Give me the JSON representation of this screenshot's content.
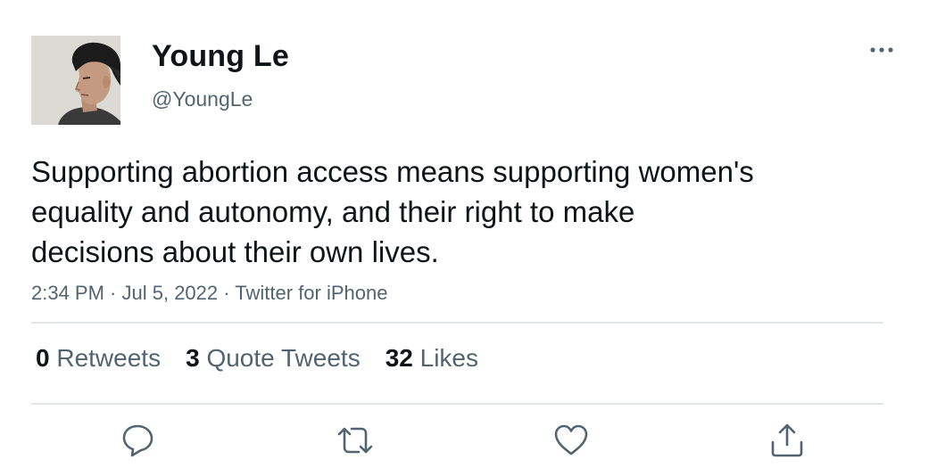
{
  "user": {
    "display_name": "Young Le",
    "handle": "@YoungLe"
  },
  "tweet": {
    "text_lines": [
      "Supporting abortion access means supporting women's",
      "equality and autonomy, and their right to make",
      "decisions about their own lives."
    ],
    "time": "2:34 PM",
    "date": "Jul 5, 2022",
    "source": "Twitter for iPhone",
    "separator": " · "
  },
  "stats": {
    "retweets_count": "0",
    "retweets_label": "Retweets",
    "quotes_count": "3",
    "quotes_label": "Quote Tweets",
    "likes_count": "32",
    "likes_label": "Likes"
  },
  "icons": {
    "more": "more-horizontal-icon",
    "reply": "reply-icon",
    "retweet": "retweet-icon",
    "like": "heart-icon",
    "share": "share-icon"
  },
  "colors": {
    "text_primary": "#0f1419",
    "text_secondary": "#536471",
    "divider": "#e3e6e9"
  }
}
